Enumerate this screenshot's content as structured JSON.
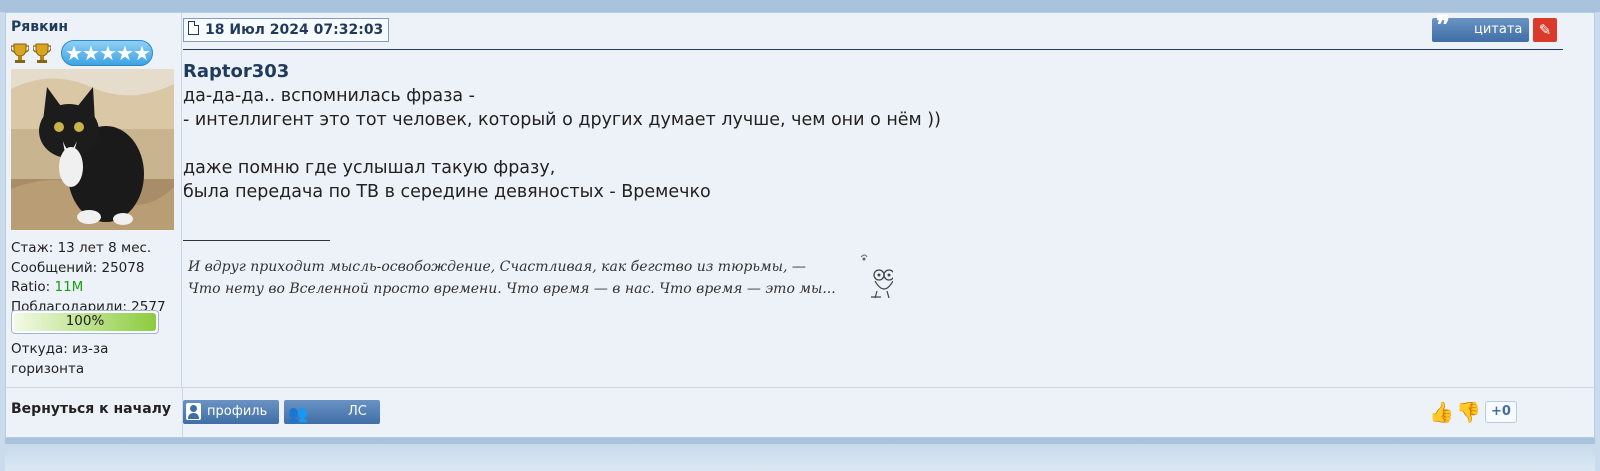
{
  "post": {
    "author": "Рявкин",
    "date": "18 Июл 2024 07:32:03",
    "quote_label": "цитата",
    "quoted_user": "Raptor303",
    "lines": [
      "да-да-да.. вспомнилась фраза -",
      "- интеллигент это тот человек, который о других думает лучше, чем они о нём ))",
      "",
      "даже помню где услышал такую фразу,",
      "была передача по ТВ в середине девяностых - Времечко"
    ],
    "signature": [
      "И вдруг приходит мысль-освобождение, Счастливая, как бегство из тюрьмы, —",
      "Что нету во Вселенной просто времени. Что время — в нас. Что время — это мы..."
    ]
  },
  "user": {
    "stats": [
      "Стаж: 13 лет 8 мес.",
      "Сообщений: 25078"
    ],
    "ratio_label": "Ratio: ",
    "ratio_value": "11M",
    "thanks": "Поблагодарили: 2577",
    "progress_text": "100%",
    "progress_value": 1.0,
    "location": "Откуда: из-за горизонта"
  },
  "footer": {
    "back_to_top": "Вернуться к началу",
    "profile_label": "профиль",
    "pm_label": "ЛС",
    "rating": "+0"
  },
  "colors": {
    "accent": "#3f6ea6",
    "header_text": "#1f3a5a",
    "ratio_green": "#1a9e1a",
    "edit_red": "#d93a2a"
  },
  "icons": {
    "date": "document-icon",
    "quote": "quote-icon",
    "edit": "edit-icon",
    "profile": "user-icon",
    "pm": "people-icon",
    "like": "thumbs-up-icon",
    "dislike": "thumbs-down-icon"
  }
}
